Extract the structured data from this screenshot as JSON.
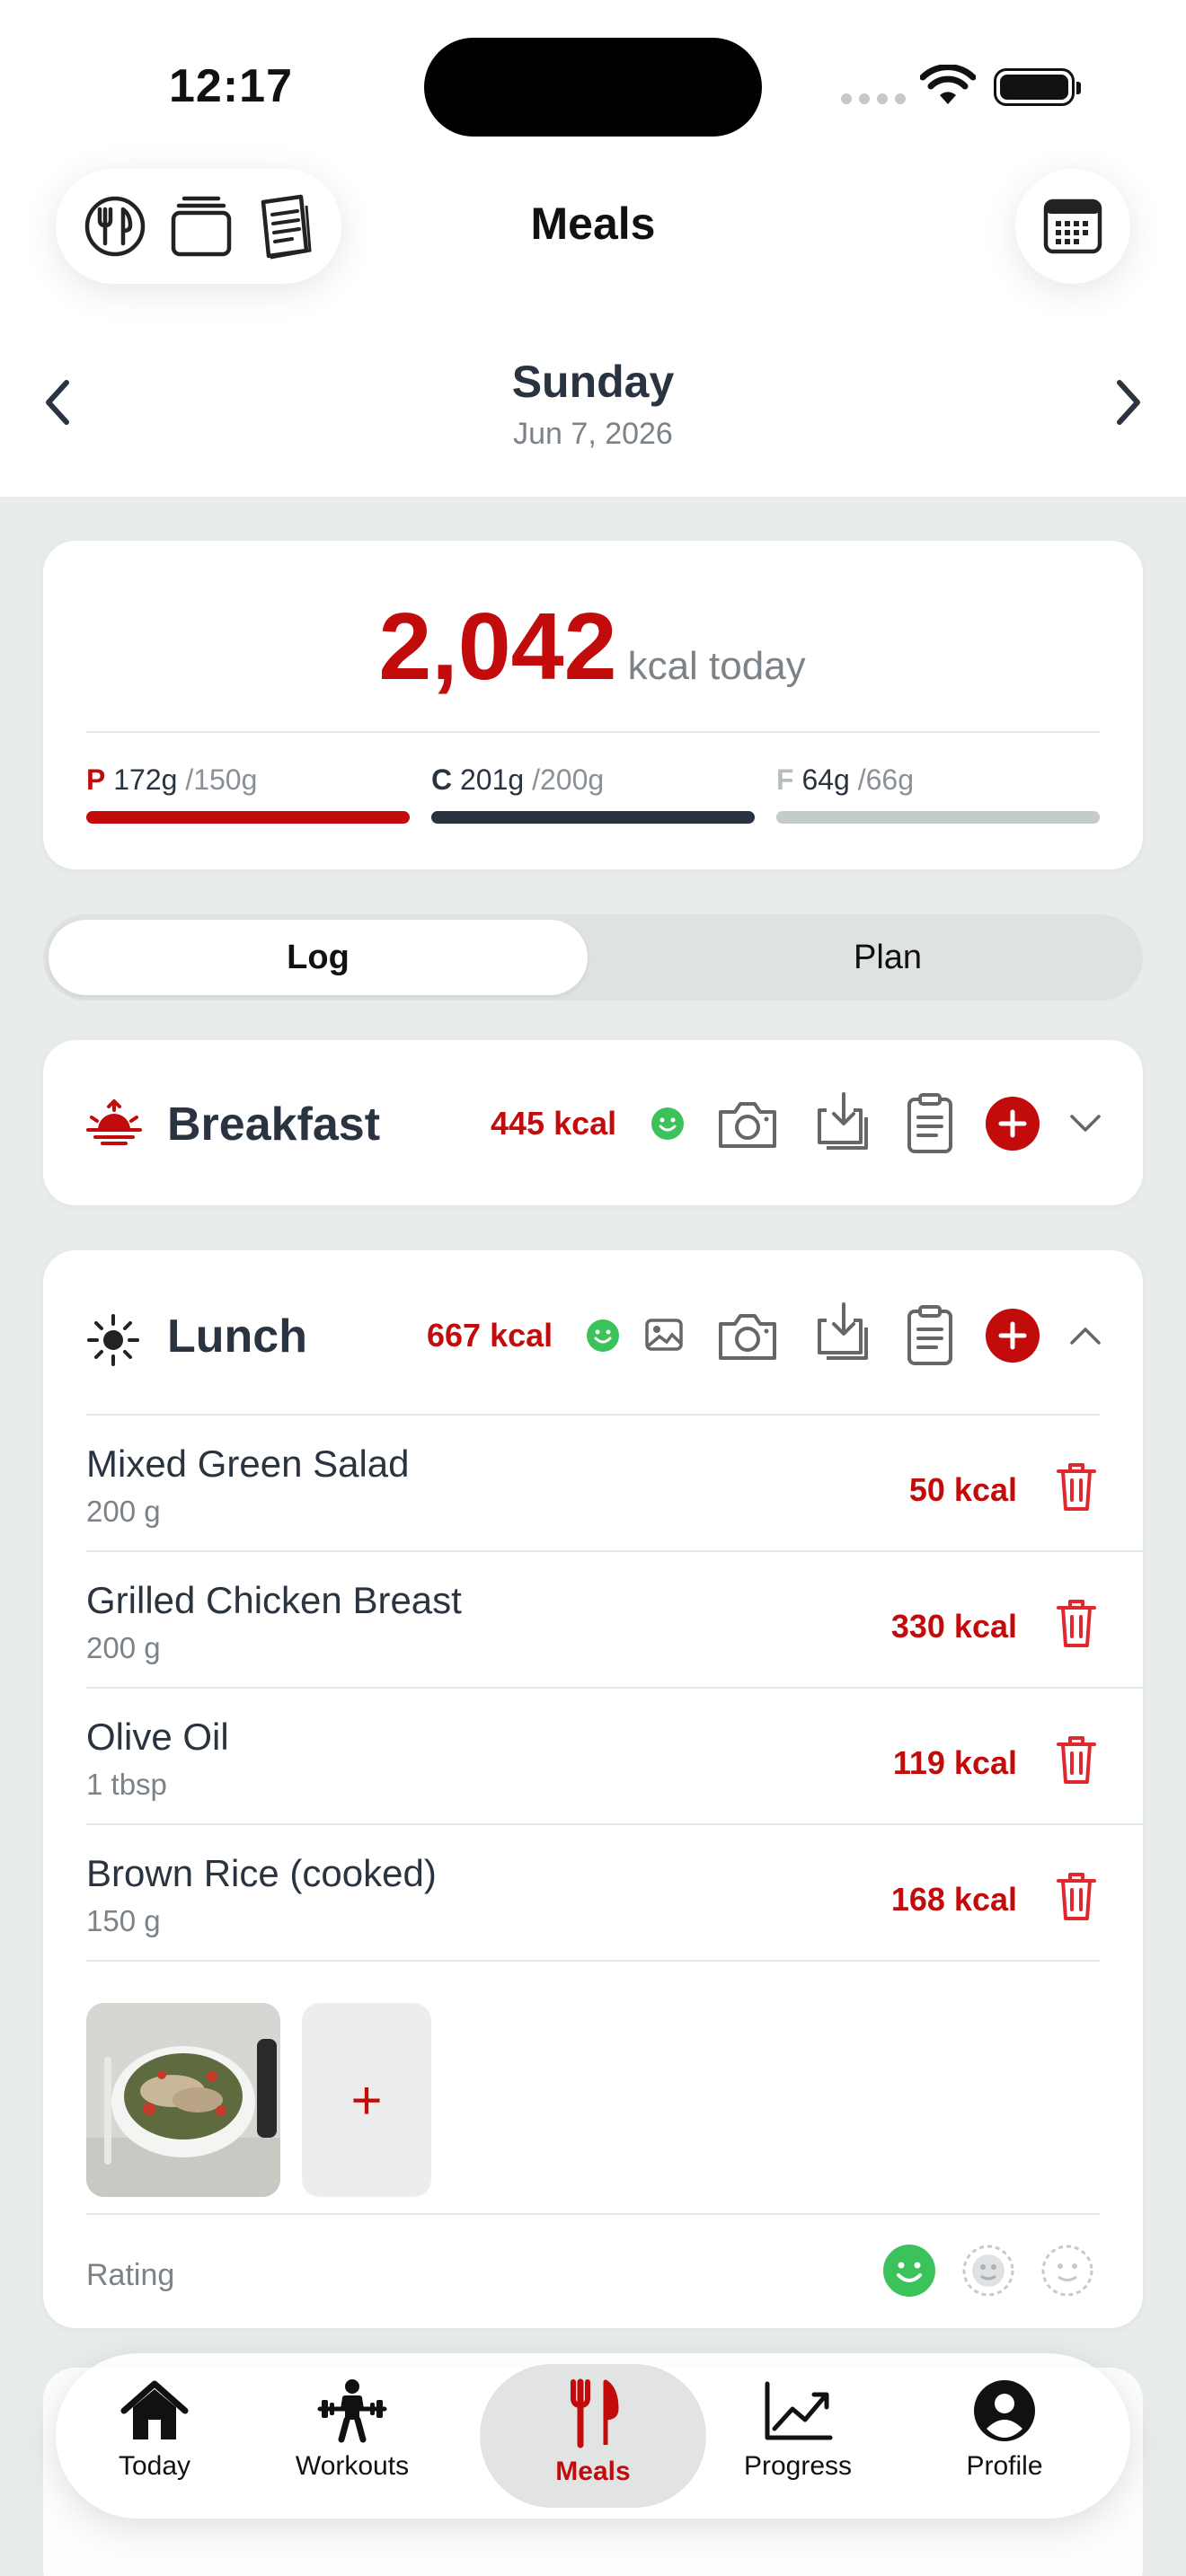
{
  "status_bar": {
    "time": "12:17"
  },
  "header": {
    "title": "Meals",
    "left_icons": [
      "utensils-icon",
      "stack-icon",
      "notebook-icon"
    ],
    "right_icon": "calendar-icon"
  },
  "date_nav": {
    "day": "Sunday",
    "date": "Jun 7, 2026"
  },
  "summary": {
    "kcal_value": "2,042",
    "kcal_label": "kcal today",
    "macros": [
      {
        "letter": "P",
        "value": "172g",
        "goal": "/150g",
        "color": "#c20c0c"
      },
      {
        "letter": "C",
        "value": "201g",
        "goal": "/200g",
        "color": "#2a3440"
      },
      {
        "letter": "F",
        "value": "64g",
        "goal": "/66g",
        "color": "#c5cbcb"
      }
    ]
  },
  "segmented": {
    "log": "Log",
    "plan": "Plan",
    "selected": "Log"
  },
  "breakfast": {
    "title": "Breakfast",
    "kcal": "445 kcal",
    "expanded": false
  },
  "lunch": {
    "title": "Lunch",
    "kcal": "667 kcal",
    "expanded": true,
    "items": [
      {
        "name": "Mixed Green Salad",
        "qty": "200 g",
        "kcal": "50 kcal"
      },
      {
        "name": "Grilled Chicken Breast",
        "qty": "200 g",
        "kcal": "330 kcal"
      },
      {
        "name": "Olive Oil",
        "qty": "1 tbsp",
        "kcal": "119 kcal"
      },
      {
        "name": "Brown Rice (cooked)",
        "qty": "150 g",
        "kcal": "168 kcal"
      }
    ],
    "add_photo_label": "+",
    "rating_label": "Rating"
  },
  "tabbar": {
    "tabs": [
      {
        "label": "Today",
        "icon": "home-icon"
      },
      {
        "label": "Workouts",
        "icon": "weightlifter-icon"
      },
      {
        "label": "Meals",
        "icon": "fork-knife-icon"
      },
      {
        "label": "Progress",
        "icon": "chart-icon"
      },
      {
        "label": "Profile",
        "icon": "profile-icon"
      }
    ],
    "active": "Meals"
  },
  "colors": {
    "accent": "#c20c0c",
    "happy": "#3cc25a",
    "background": "#e8ecec"
  }
}
